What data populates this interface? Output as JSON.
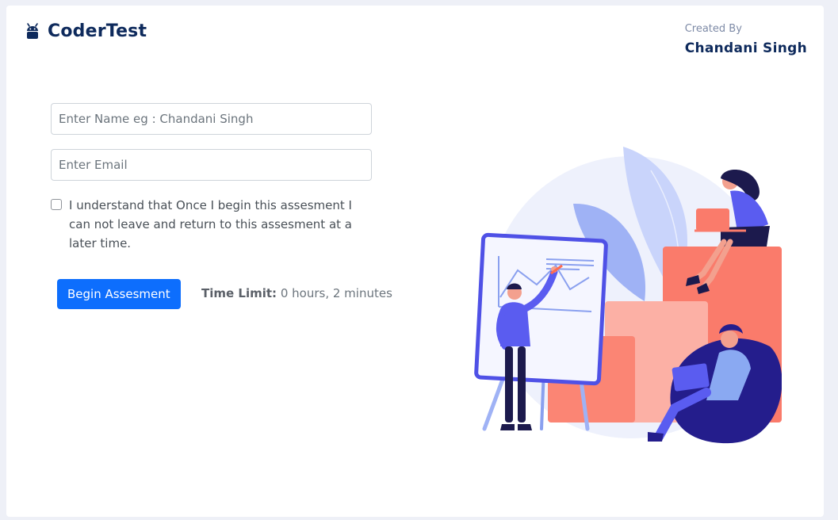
{
  "brand": {
    "name": "CoderTest",
    "icon": "android-icon"
  },
  "creator": {
    "label": "Created By",
    "name": "Chandani Singh"
  },
  "form": {
    "name_placeholder": "Enter Name eg : Chandani Singh",
    "name_value": "",
    "email_placeholder": "Enter Email",
    "email_value": "",
    "agree_checked": false,
    "agree_text": "I understand that Once I begin this assesment I can not leave and return to this assesment at a later time.",
    "begin_label": "Begin Assesment",
    "time_limit_label": "Time Limit:",
    "time_limit_value": "0 hours, 2 minutes"
  },
  "colors": {
    "primary": "#0d6efd",
    "brand_text": "#0e2a5c",
    "illustration_accent": "#5a5cf0",
    "illustration_block": "#fa7b6b"
  }
}
